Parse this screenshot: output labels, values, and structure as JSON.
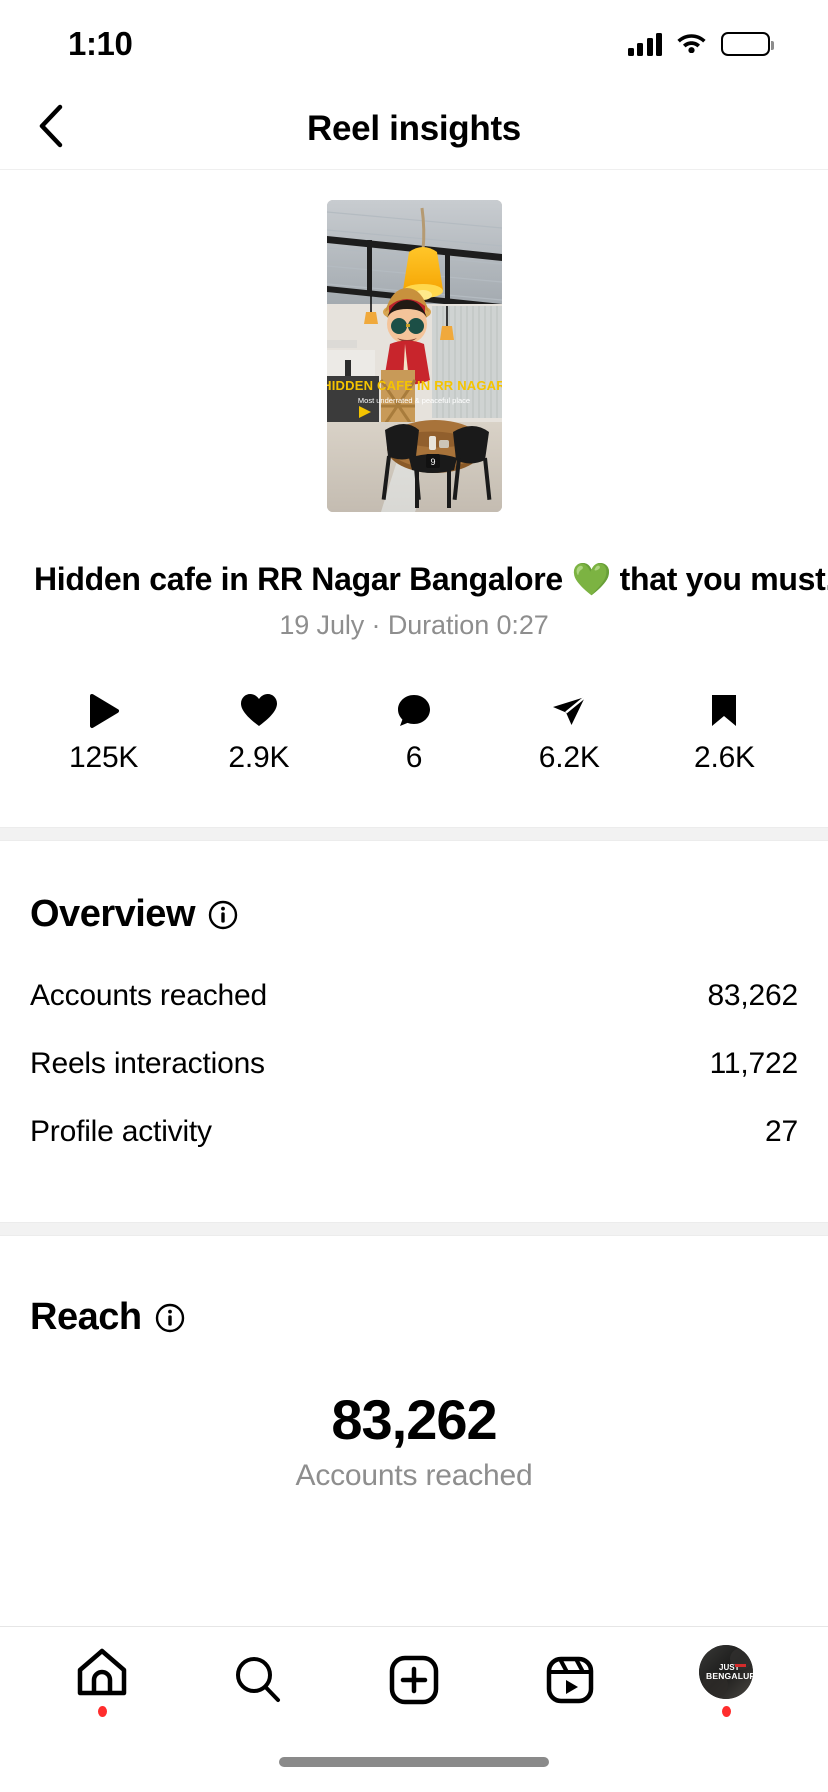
{
  "status_bar": {
    "time": "1:10",
    "signal_icon": "cellular-signal-icon",
    "wifi_icon": "wifi-icon",
    "battery_icon": "battery-icon"
  },
  "header": {
    "title": "Reel insights",
    "back_icon": "back-chevron-icon"
  },
  "post": {
    "thumbnail_alt": "reel-thumbnail",
    "thumbnail_overlay_title": "HIDDEN CAFE IN RR NAGAR",
    "thumbnail_overlay_subtitle": "Most underrated & peaceful place",
    "caption_text": "Hidden cafe in RR Nagar Bangalore ",
    "caption_emoji": "💚",
    "caption_tail": " that you must...",
    "meta": "19 July · Duration 0:27"
  },
  "stats": [
    {
      "icon": "play-icon",
      "value": "125K"
    },
    {
      "icon": "heart-icon",
      "value": "2.9K"
    },
    {
      "icon": "comment-icon",
      "value": "6"
    },
    {
      "icon": "share-icon",
      "value": "6.2K"
    },
    {
      "icon": "bookmark-icon",
      "value": "2.6K"
    }
  ],
  "overview": {
    "title": "Overview",
    "info_icon": "info-circle-icon",
    "rows": [
      {
        "label": "Accounts reached",
        "value": "83,262"
      },
      {
        "label": "Reels interactions",
        "value": "11,722"
      },
      {
        "label": "Profile activity",
        "value": "27"
      }
    ]
  },
  "reach": {
    "title": "Reach",
    "info_icon": "info-circle-icon",
    "big_number": "83,262",
    "big_label": "Accounts reached"
  },
  "tab_bar": [
    {
      "name": "home",
      "icon": "home-icon",
      "badge": true
    },
    {
      "name": "search",
      "icon": "search-icon",
      "badge": false
    },
    {
      "name": "create",
      "icon": "plus-box-icon",
      "badge": false
    },
    {
      "name": "reels",
      "icon": "reels-icon",
      "badge": false
    },
    {
      "name": "profile",
      "icon": "avatar-icon",
      "badge": true,
      "avatar_top": "JUST",
      "avatar_bottom": "BENGALURU"
    }
  ],
  "colors": {
    "accent_green": "#44d62c",
    "badge_red": "#ff2d2d",
    "muted": "#8e8e8e",
    "band": "#f2f2f2"
  }
}
